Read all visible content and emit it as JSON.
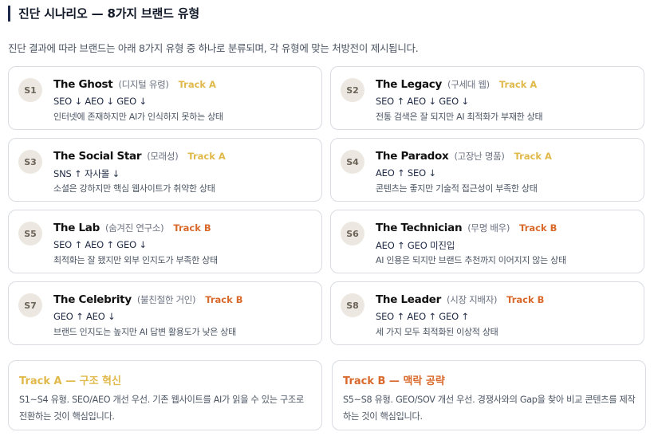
{
  "header": {
    "title": "진단 시나리오 — 8가지 브랜드 유형",
    "subtitle": "진단 결과에 따라 브랜드는 아래 8가지 유형 중 하나로 분류되며, 각 유형에 맞는 처방전이 제시됩니다."
  },
  "scenarios": [
    {
      "code": "S1",
      "name": "The Ghost",
      "alias": "(디지털 유령)",
      "track": "Track A",
      "signals": "SEO ↓ AEO ↓ GEO ↓",
      "desc": "인터넷에 존재하지만 AI가 인식하지 못하는 상태"
    },
    {
      "code": "S2",
      "name": "The Legacy",
      "alias": "(구세대 웹)",
      "track": "Track A",
      "signals": "SEO ↑ AEO ↓ GEO ↓",
      "desc": "전통 검색은 잘 되지만 AI 최적화가 부재한 상태"
    },
    {
      "code": "S3",
      "name": "The Social Star",
      "alias": "(모래성)",
      "track": "Track A",
      "signals": "SNS ↑ 자사몰 ↓",
      "desc": "소셜은 강하지만 핵심 웹사이트가 취약한 상태"
    },
    {
      "code": "S4",
      "name": "The Paradox",
      "alias": "(고장난 명품)",
      "track": "Track A",
      "signals": "AEO ↑ SEO ↓",
      "desc": "콘텐츠는 좋지만 기술적 접근성이 부족한 상태"
    },
    {
      "code": "S5",
      "name": "The Lab",
      "alias": "(숨겨진 연구소)",
      "track": "Track B",
      "signals": "SEO ↑ AEO ↑ GEO ↓",
      "desc": "최적화는 잘 됐지만 외부 인지도가 부족한 상태"
    },
    {
      "code": "S6",
      "name": "The Technician",
      "alias": "(무명 배우)",
      "track": "Track B",
      "signals": "AEO ↑ GEO 미진입",
      "desc": "AI 인용은 되지만 브랜드 추천까지 이어지지 않는 상태"
    },
    {
      "code": "S7",
      "name": "The Celebrity",
      "alias": "(불친절한 거인)",
      "track": "Track B",
      "signals": "GEO ↑ AEO ↓",
      "desc": "브랜드 인지도는 높지만 AI 답변 활용도가 낮은 상태"
    },
    {
      "code": "S8",
      "name": "The Leader",
      "alias": "(시장 지배자)",
      "track": "Track B",
      "signals": "SEO ↑ AEO ↑ GEO ↑",
      "desc": "세 가지 모두 최적화된 이상적 상태"
    }
  ],
  "tracks": [
    {
      "title": "Track A — 구조 혁신",
      "text": "S1~S4 유형. SEO/AEO 개선 우선. 기존 웹사이트를 AI가 읽을 수 있는 구조로 전환하는 것이 핵심입니다.",
      "color": "#e0b94a"
    },
    {
      "title": "Track B — 맥락 공략",
      "text": "S5~S8 유형. GEO/SOV 개선 우선. 경쟁사와의 Gap을 찾아 비교 콘텐츠를 제작하는 것이 핵심입니다.",
      "color": "#d9692b"
    }
  ],
  "colors": {
    "track_a": "#e0b94a",
    "track_b": "#d9692b",
    "accent": "#1e2a4a"
  }
}
